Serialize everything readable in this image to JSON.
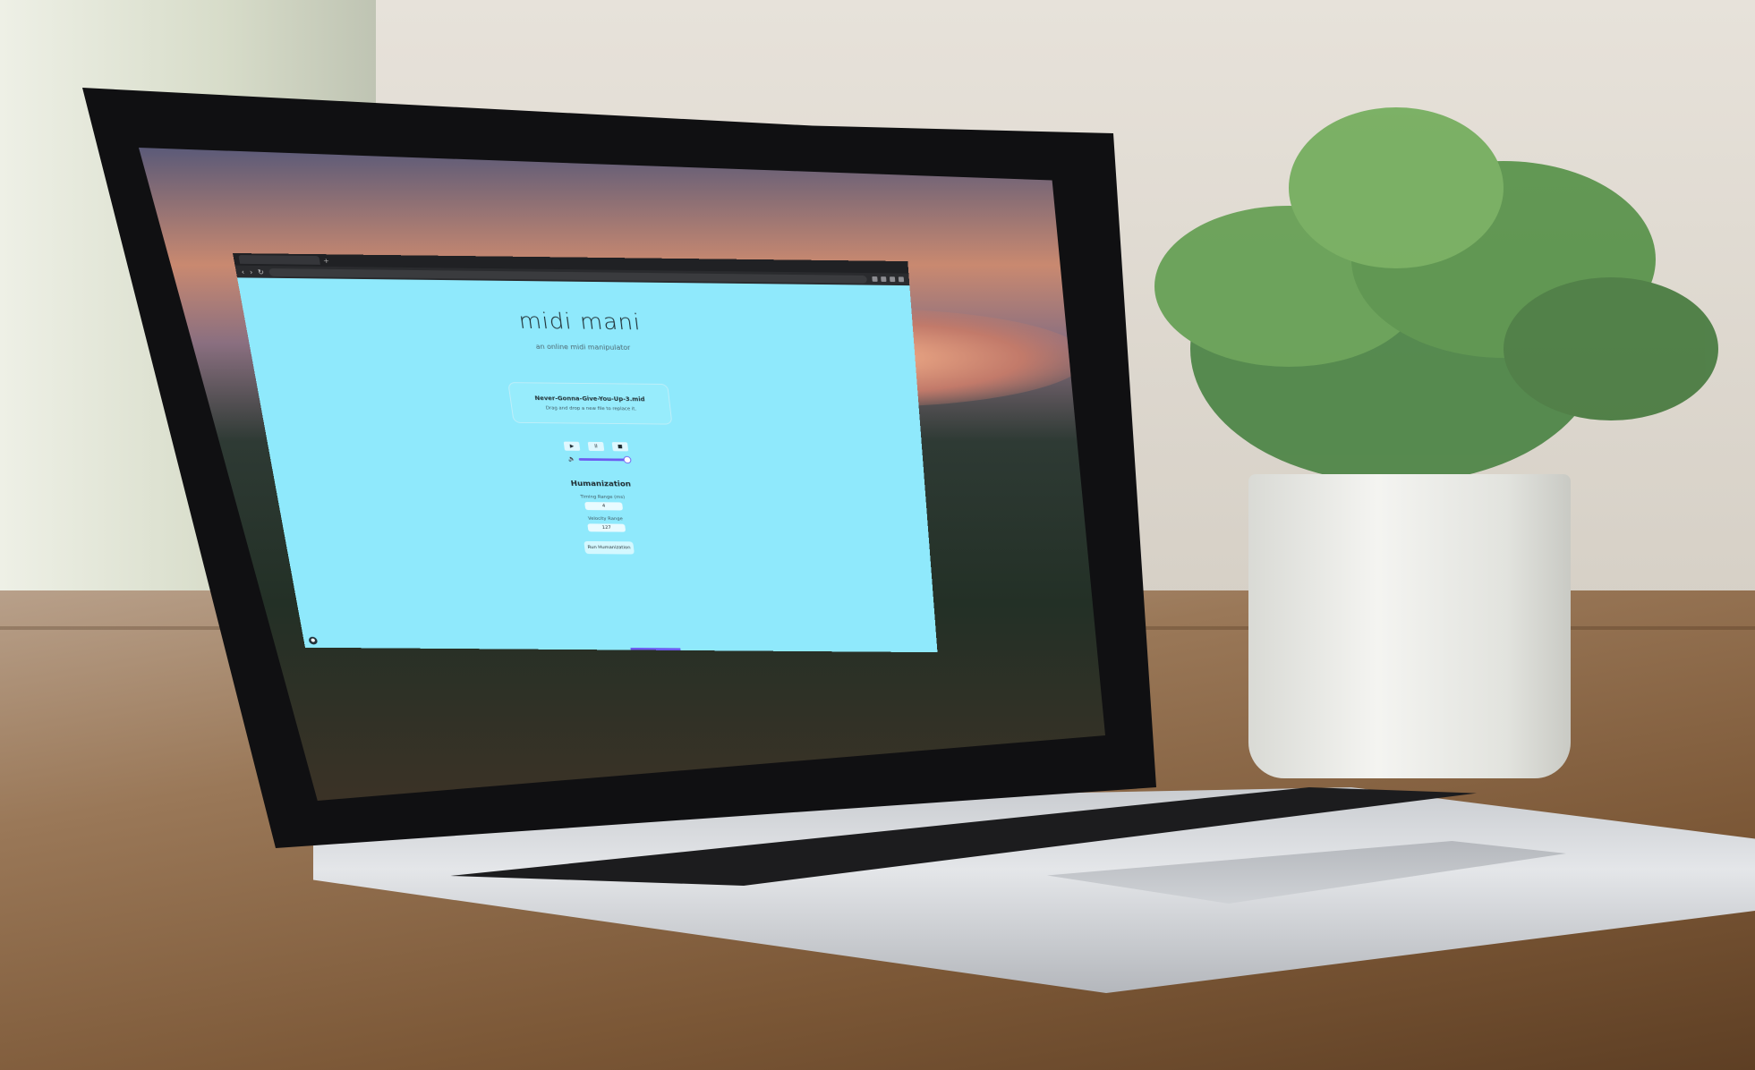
{
  "browser": {
    "tab_title": "",
    "new_tab_label": "+",
    "nav": {
      "back": "‹",
      "forward": "›",
      "reload": "↻"
    }
  },
  "app": {
    "title": "midi mani",
    "subtitle": "an online midi manipulator",
    "dropzone": {
      "filename": "Never-Gonna-Give-You-Up-3.mid",
      "hint": "Drag and drop a new file to replace it."
    },
    "controls": {
      "play": "▶",
      "pause": "II",
      "stop": "■"
    },
    "volume": {
      "icon": "🔈",
      "level": 1.0
    },
    "humanization": {
      "title": "Humanization",
      "timing_label": "Timing Range (ms)",
      "timing_value": "4",
      "velocity_label": "Velocity Range",
      "velocity_value": "127",
      "run_label": "Run Humanization"
    }
  }
}
